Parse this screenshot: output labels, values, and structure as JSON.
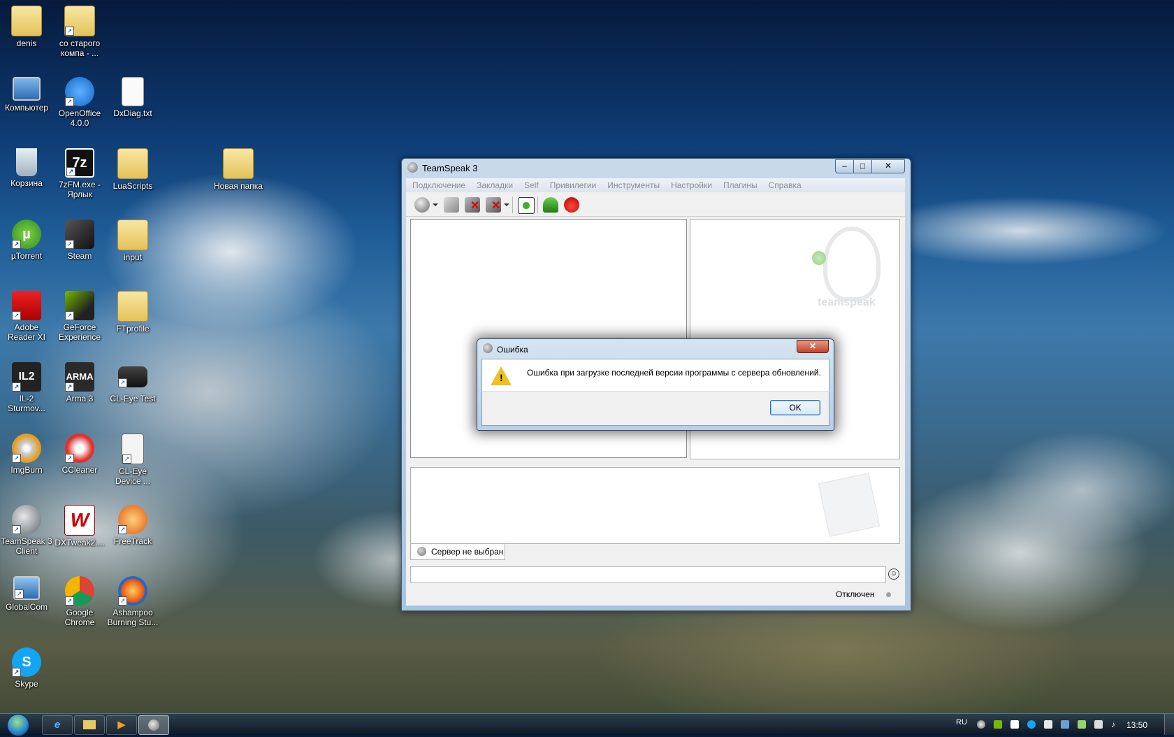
{
  "desktop": {
    "icons": {
      "denis": "denis",
      "co_starogo": "со старого компа - ...",
      "computer": "Компьютер",
      "openoffice": "OpenOffice 4.0.0",
      "dxdiag": "DxDiag.txt",
      "recycle": "Корзина",
      "sevenzip": "7zFM.exe - Ярлык",
      "luascripts": "LuaScripts",
      "new_folder": "Новая папка",
      "utorrent": "µTorrent",
      "steam": "Steam",
      "input": "input",
      "adobe": "Adobe Reader XI",
      "geforce": "GeForce Experience",
      "ftprofile": "FTprofile",
      "il2": "IL-2 Sturmov...",
      "arma3": "Arma 3",
      "cleye_test": "CL-Eye Test",
      "imgburn": "ImgBurn",
      "ccleaner": "CCleaner",
      "cleye_device": "CL-Eye Device ...",
      "teamspeak": "TeamSpeak 3 Client",
      "dxtweak": "DXTweak2....",
      "freetrack": "FreeTrack",
      "globalcom": "GlobalCom",
      "chrome": "Google Chrome",
      "ashampoo": "Ashampoo Burning Stu...",
      "skype": "Skype"
    }
  },
  "teamspeak_window": {
    "title": "TeamSpeak 3",
    "menu": [
      "Подключение",
      "Закладки",
      "Self",
      "Привилегии",
      "Инструменты",
      "Настройки",
      "Плагины",
      "Справка"
    ],
    "toolbar_icons": [
      "connect-icon",
      "disconnect-icon",
      "mute-microphone-icon",
      "mute-speakers-icon",
      "away-icon",
      "subscribe-icon",
      "contacts-icon",
      "teamspeak-flame-icon"
    ],
    "logo_text": "teamspeak",
    "server_tab_label": "Сервер не выбран",
    "status_text": "Отключен"
  },
  "error_dialog": {
    "title": "Ошибка",
    "message": "Ошибка при загрузке последней версии программы с сервера обновлений.",
    "ok_label": "OK"
  },
  "taskbar": {
    "language": "RU",
    "clock": "13:50"
  },
  "colors": {
    "accent": "#2a6ec7",
    "warning": "#f0c020",
    "close_button": "#c0442b"
  }
}
